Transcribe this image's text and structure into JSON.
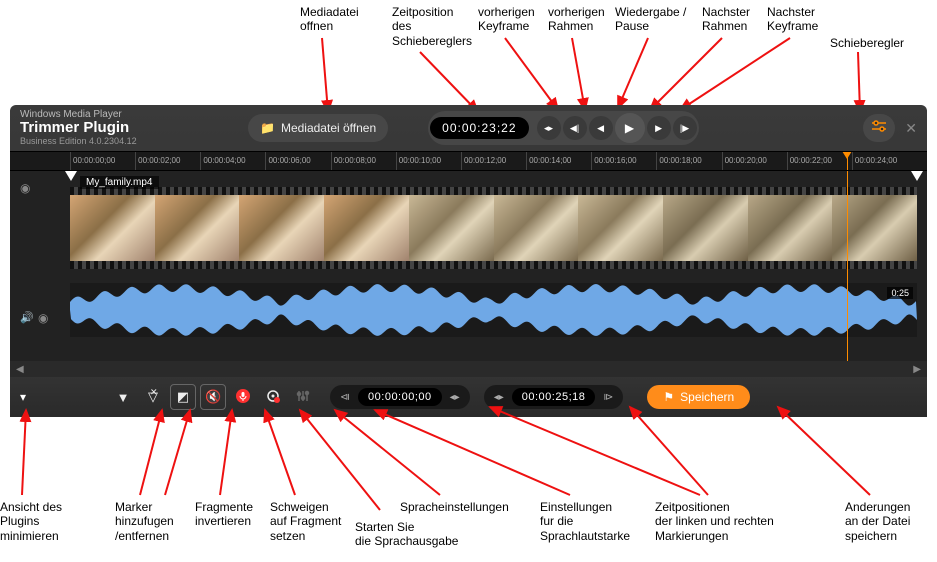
{
  "app_title": "Windows Media Player",
  "plugin_title": "Trimmer Plugin",
  "version": "Business Edition 4.0.2304.12",
  "open_media_label": "Mediadatei öffnen",
  "timecode": "00:00:23;22",
  "ruler_ticks": [
    "00:00:00;00",
    "00:00:02;00",
    "00:00:04;00",
    "00:00:06;00",
    "00:00:08;00",
    "00:00:10;00",
    "00:00:12;00",
    "00:00:14;00",
    "00:00:16;00",
    "00:00:18;00",
    "00:00:20;00",
    "00:00:22;00",
    "00:00:24;00"
  ],
  "track_filename": "My_family.mp4",
  "track_duration": "0:25",
  "left_marker_tc": "00:00:00;00",
  "right_marker_tc": "00:00:25;18",
  "save_label": "Speichern",
  "annotations": {
    "top": {
      "open_media": "Mediadatei\noffnen",
      "timecode": "Zeitposition\ndes\nSchiebereglers",
      "prev_keyframe": "vorherigen\nKeyframe",
      "prev_frame": "vorherigen\nRahmen",
      "play_pause": "Wiedergabe /\nPause",
      "next_frame": "Nachster\nRahmen",
      "next_keyframe": "Nachster\nKeyframe",
      "slider": "Schieberegler"
    },
    "bottom": {
      "minimize": "Ansicht des\nPlugins\nminimieren",
      "marker": "Marker\nhinzufugen\n/entfernen",
      "invert": "Fragmente\ninvertieren",
      "mute": "Schweigen\nauf Fragment\nsetzen",
      "voice_start": "Starten Sie\ndie Sprachausgabe",
      "voice_settings": "Spracheinstellungen",
      "volume_settings": "Einstellungen\nfur die\nSprachlautstarke",
      "marker_positions": "Zeitpositionen\nder linken und rechten\nMarkierungen",
      "save": "Anderungen\nan der Datei\nspeichern"
    }
  },
  "colors": {
    "accent": "#ff8c1a"
  }
}
